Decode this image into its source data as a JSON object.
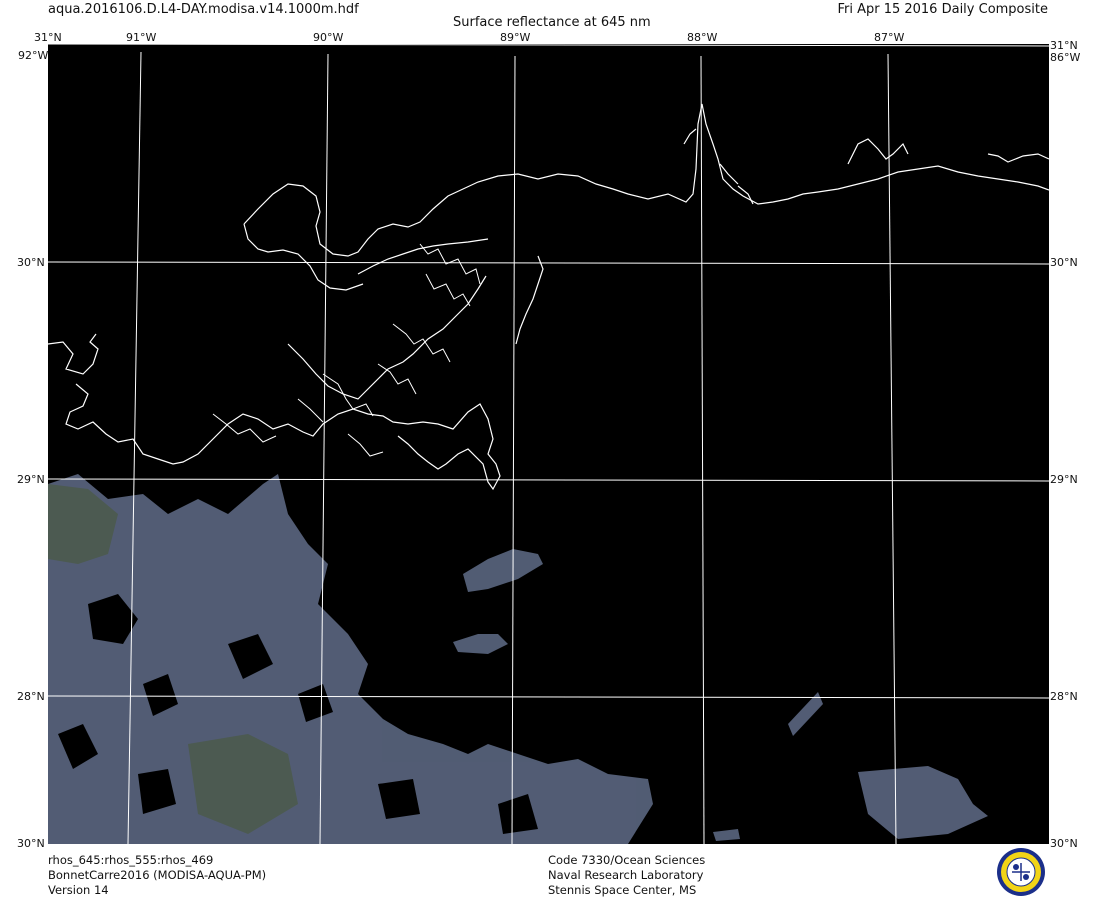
{
  "header": {
    "filename": "aqua.2016106.D.L4-DAY.modisa.v14.1000m.hdf",
    "title": "Surface reflectance at 645 nm",
    "date": "Fri Apr 15 2016 Daily Composite"
  },
  "axes": {
    "lon_labels": [
      "91°W",
      "90°W",
      "89°W",
      "88°W",
      "87°W"
    ],
    "lat_labels": [
      "30°N",
      "29°N",
      "28°N"
    ],
    "corner_top": "31°N",
    "corner_bottom": "30°N",
    "corner_lon_top": "92°W",
    "corner_lon_right": "86°W"
  },
  "footer": {
    "left": [
      "rhos_645:rhos_555:rhos_469",
      "BonnetCarre2016 (MODISA-AQUA-PM)",
      "Version 14"
    ],
    "center": [
      "Code 7330/Ocean Sciences",
      "Naval Research Laboratory",
      "Stennis Space Center, MS"
    ]
  },
  "colors": {
    "background": "#000000",
    "coastline": "#ffffff",
    "graticule": "#ffffff",
    "cloud": "#5a6478",
    "land": "#4c5a4c"
  },
  "icons": {
    "logo": "naval-research-lab-seal-icon"
  }
}
